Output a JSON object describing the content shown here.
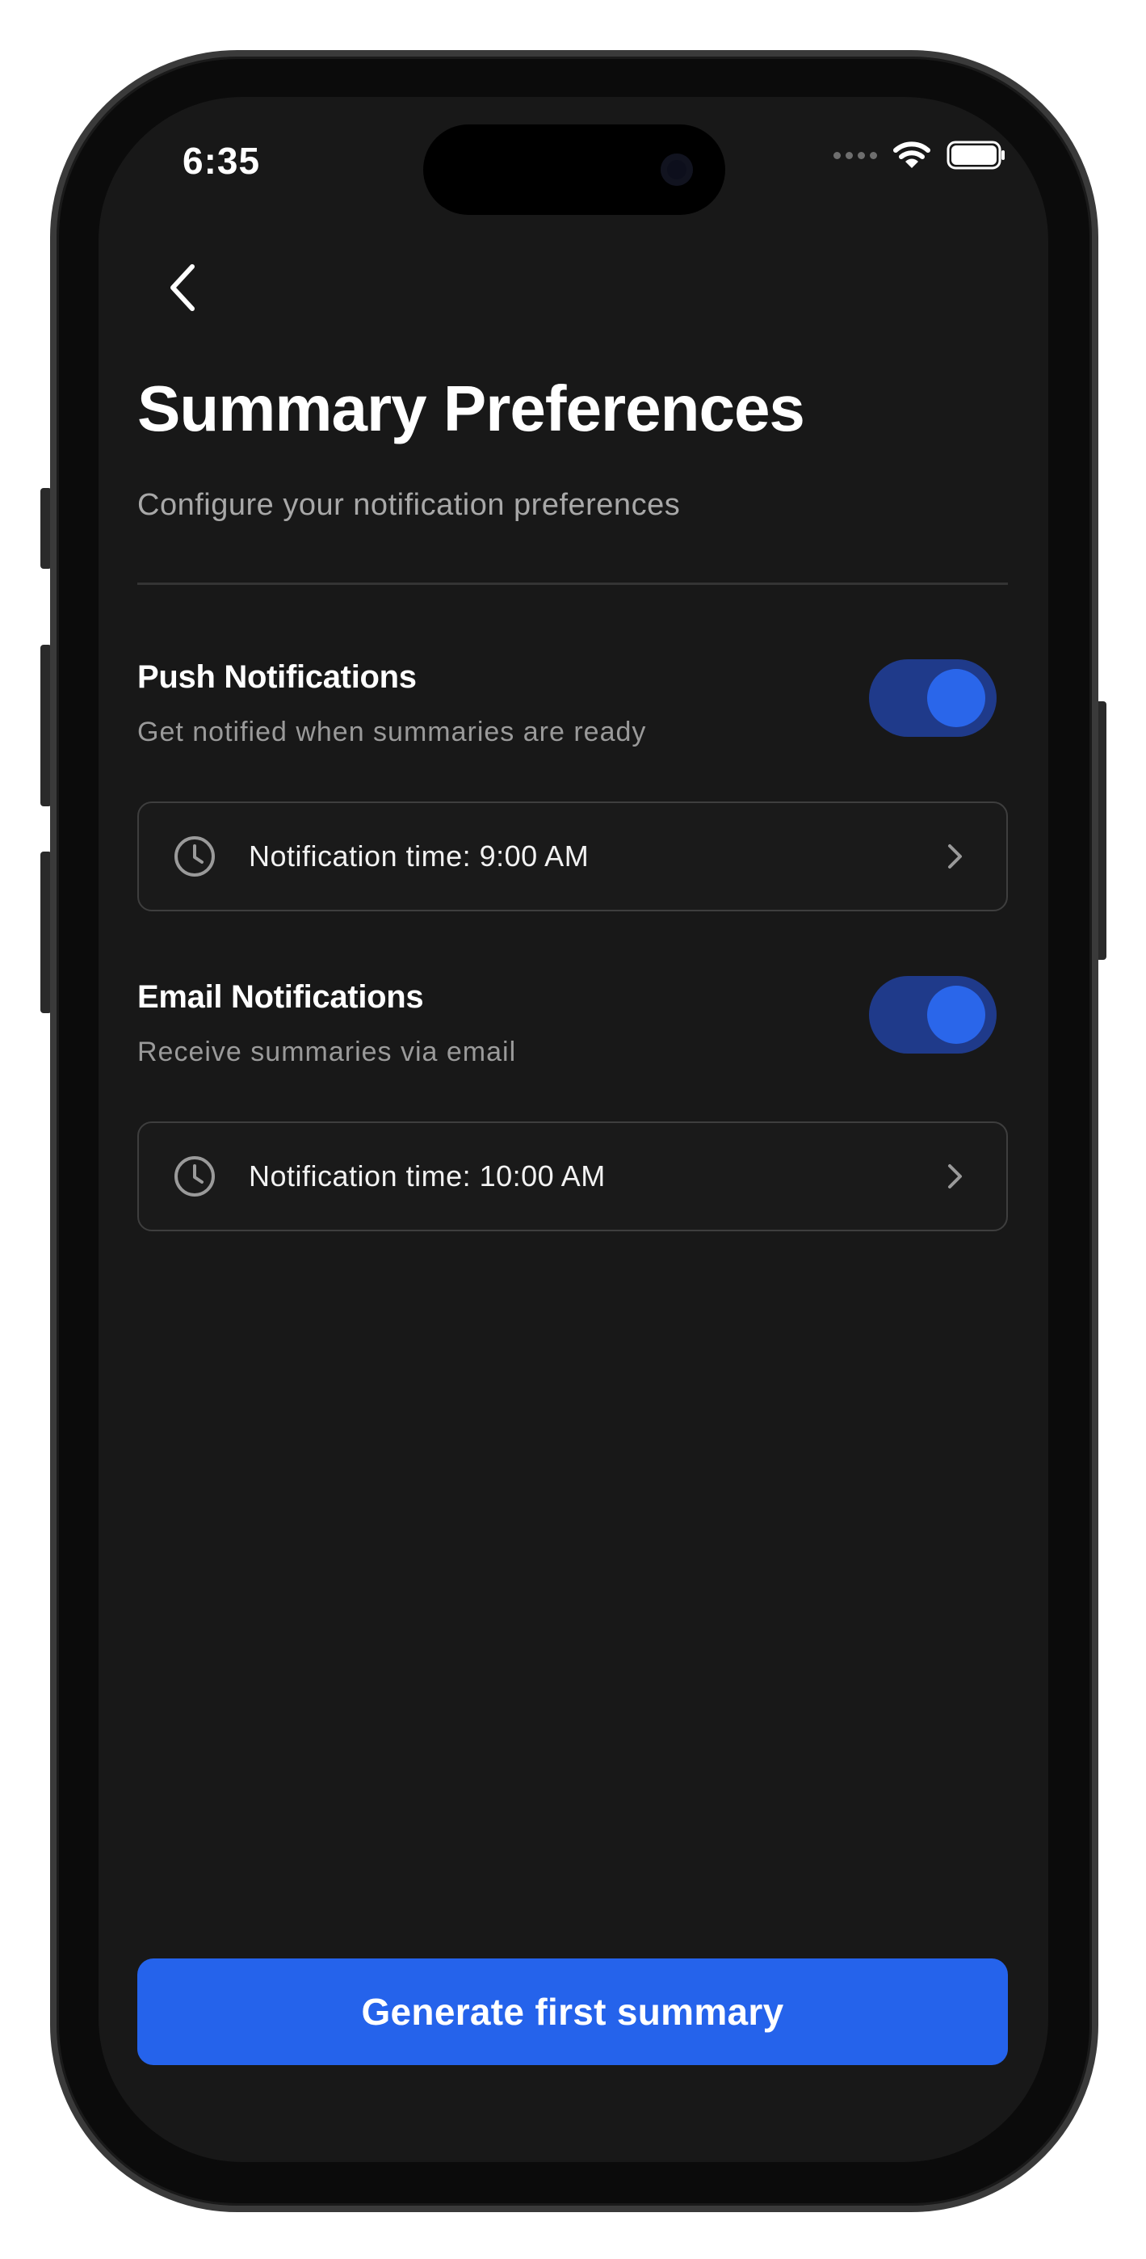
{
  "status_bar": {
    "time": "6:35"
  },
  "header": {
    "back_label": "Back",
    "title": "Summary Preferences",
    "subtitle": "Configure your notification preferences"
  },
  "preferences": [
    {
      "title": "Push Notifications",
      "description": "Get notified when summaries are ready",
      "enabled": true,
      "time_label": "Notification time: 9:00 AM"
    },
    {
      "title": "Email Notifications",
      "description": "Receive summaries via email",
      "enabled": true,
      "time_label": "Notification time: 10:00 AM"
    }
  ],
  "cta": {
    "label": "Generate first summary"
  },
  "icons": {
    "back": "chevron-left-icon",
    "clock": "clock-icon",
    "row_chevron": "chevron-right-icon",
    "wifi": "wifi-icon",
    "battery": "battery-icon"
  },
  "colors": {
    "background": "#181818",
    "accent": "#2563eb",
    "toggle_track": "#1f3a8a",
    "text_primary": "#ffffff",
    "text_secondary": "#9a9a9a"
  }
}
